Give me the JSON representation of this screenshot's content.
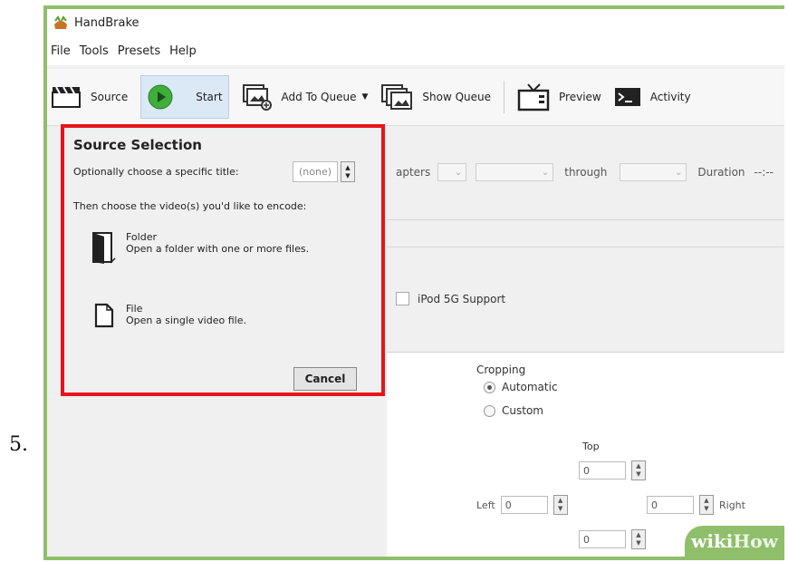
{
  "step_number": "5.",
  "window": {
    "title": "HandBrake"
  },
  "menu": [
    "File",
    "Tools",
    "Presets",
    "Help"
  ],
  "toolbar": {
    "source": "Source",
    "start": "Start",
    "add_to_queue": "Add To Queue",
    "show_queue": "Show Queue",
    "preview": "Preview",
    "activity": "Activity"
  },
  "background": {
    "chapters_label": "apters",
    "through_label": "through",
    "duration_label": "Duration",
    "duration_value": "--:--",
    "ipod_label": "iPod 5G Support"
  },
  "dialog": {
    "title": "Source Selection",
    "title_prompt": "Optionally choose a specific title:",
    "title_value": "(none)",
    "choose_prompt": "Then choose the video(s) you'd like to encode:",
    "folder_title": "Folder",
    "folder_desc": "Open a folder with one or more files.",
    "file_title": "File",
    "file_desc": "Open a single video file.",
    "cancel": "Cancel"
  },
  "cropping": {
    "label": "Cropping",
    "automatic": "Automatic",
    "custom": "Custom",
    "selected": "Automatic",
    "top_label": "Top",
    "top": "0",
    "left_label": "Left",
    "left": "0",
    "right_label": "Right",
    "right": "0",
    "bottom": "0"
  },
  "watermark": {
    "part1": "wiki",
    "part2": "How"
  },
  "colors": {
    "highlight_border": "#e8141b",
    "frame": "#8fbf6a",
    "start_green": "#3fae3a"
  }
}
